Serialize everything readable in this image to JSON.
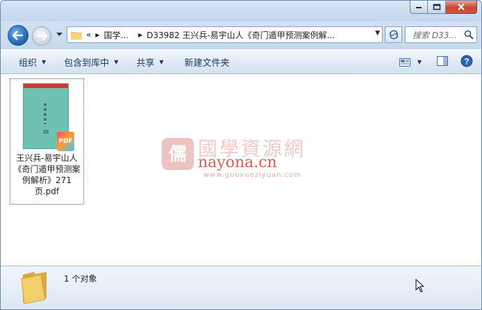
{
  "address": {
    "overflow": "«",
    "crumbs": [
      "国学...",
      "D33982 王兴兵-易宇山人《奇门遁甲预测案例解..."
    ]
  },
  "search": {
    "placeholder": "搜索 D33..."
  },
  "toolbar": {
    "organize": "组织",
    "include_library": "包含到库中",
    "share": "共享",
    "new_folder": "新建文件夹"
  },
  "files": [
    {
      "name": "王兴兵-易宇山人《奇门遁甲预测案例解析》271页.pdf",
      "badge": "PDF",
      "cover_label": "PDF"
    }
  ],
  "watermark": {
    "cn": "國學資源網",
    "en": "nayona.cn",
    "url": "www.guoxueziyuan.com",
    "logo": "儒"
  },
  "status": {
    "count_text": "1 个对象"
  },
  "colors": {
    "accent": "#1e395b",
    "close": "#c7462e"
  }
}
